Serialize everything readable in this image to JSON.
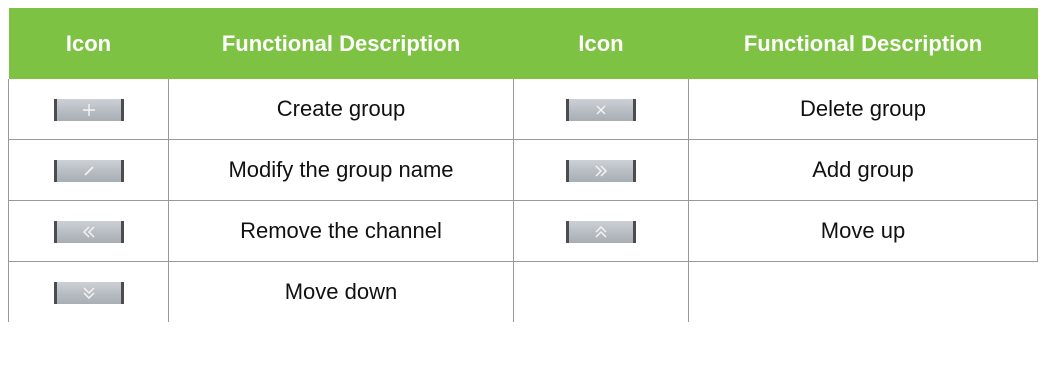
{
  "table": {
    "headers": [
      "Icon",
      "Functional Description",
      "Icon",
      "Functional Description"
    ],
    "rows": [
      [
        {
          "icon": "plus-icon",
          "label": "Create group"
        },
        {
          "icon": "close-icon",
          "label": "Delete group"
        }
      ],
      [
        {
          "icon": "edit-pencil-icon",
          "label": "Modify the group name"
        },
        {
          "icon": "double-chevron-right-icon",
          "label": "Add group"
        }
      ],
      [
        {
          "icon": "double-chevron-left-icon",
          "label": "Remove the channel"
        },
        {
          "icon": "double-chevron-up-icon",
          "label": "Move up"
        }
      ],
      [
        {
          "icon": "double-chevron-down-icon",
          "label": "Move down"
        }
      ]
    ]
  },
  "colors": {
    "header_background": "#7dc242",
    "header_text": "#ffffff",
    "grid_lines": "#9a9a9a",
    "icon_button": "#b9bec4"
  }
}
